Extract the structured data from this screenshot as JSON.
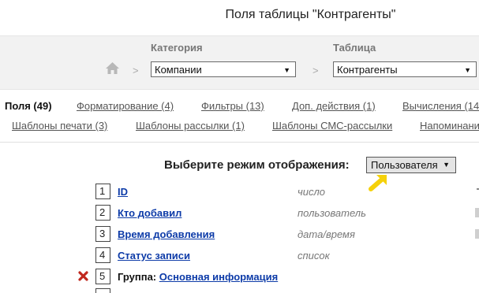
{
  "page": {
    "title": "Поля таблицы \"Контрагенты\""
  },
  "selectors": {
    "category": {
      "label": "Категория",
      "value": "Компании"
    },
    "table": {
      "label": "Таблица",
      "value": "Контрагенты"
    },
    "separator": ">"
  },
  "tabs_row1": [
    {
      "label": "Поля (49)",
      "active": true
    },
    {
      "label": "Форматирование (4)",
      "active": false
    },
    {
      "label": "Фильтры (13)",
      "active": false
    },
    {
      "label": "Доп. действия (1)",
      "active": false
    },
    {
      "label": "Вычисления (14",
      "active": false
    }
  ],
  "tabs_row2": [
    {
      "label": "Шаблоны печати (3)"
    },
    {
      "label": "Шаблоны рассылки (1)"
    },
    {
      "label": "Шаблоны СМС-рассылки"
    },
    {
      "label": "Напоминани"
    }
  ],
  "display_mode": {
    "label": "Выберите режим отображения:",
    "value": "Пользователя"
  },
  "fields": [
    {
      "num": "1",
      "name": "ID",
      "type": "число"
    },
    {
      "num": "2",
      "name": "Кто добавил",
      "type": "пользователь"
    },
    {
      "num": "3",
      "name": "Время добавления",
      "type": "дата/время"
    },
    {
      "num": "4",
      "name": "Статус записи",
      "type": "список"
    }
  ],
  "group_row": {
    "num": "5",
    "prefix": "Группа:",
    "name": "Основная информация"
  },
  "colors": {
    "link": "#0d3ba8",
    "band": "#f2f2f2",
    "pointer": "#f5d10a",
    "delete": "#c0281e"
  }
}
